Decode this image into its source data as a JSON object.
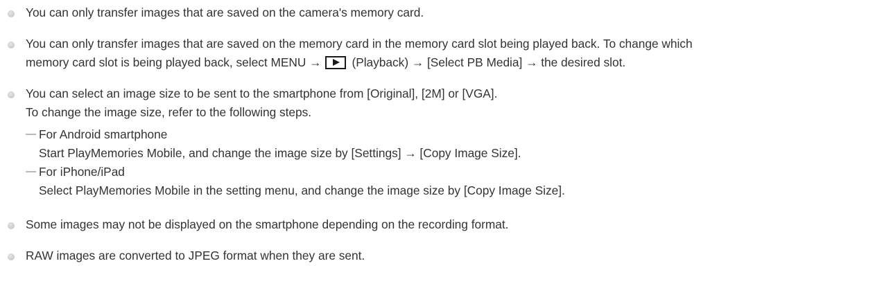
{
  "notes": [
    {
      "lines": [
        "You can only transfer images that are saved on the camera's memory card."
      ]
    },
    {
      "line1": "You can only transfer images that are saved on the memory card in the memory card slot being played back. To change which",
      "line2_before": "memory card slot is being played back, select MENU →",
      "playback_icon": "playback-icon",
      "line2_after": "(Playback) → [Select PB Media] → the desired slot."
    },
    {
      "lines": [
        "You can select an image size to be sent to the smartphone from [Original], [2M] or [VGA].",
        "To change the image size, refer to the following steps."
      ],
      "sub_items": [
        {
          "title": "For Android smartphone",
          "detail": "Start PlayMemories Mobile, and change the image size by [Settings] → [Copy Image Size]."
        },
        {
          "title": "For iPhone/iPad",
          "detail": "Select PlayMemories Mobile in the setting menu, and change the image size by [Copy Image Size]."
        }
      ]
    },
    {
      "lines": [
        "Some images may not be displayed on the smartphone depending on the recording format."
      ]
    },
    {
      "lines": [
        "RAW images are converted to JPEG format when they are sent."
      ]
    }
  ],
  "colors": {
    "text": "#333333",
    "bullet": "#cdcdcd",
    "dash": "#b9b9b9"
  }
}
